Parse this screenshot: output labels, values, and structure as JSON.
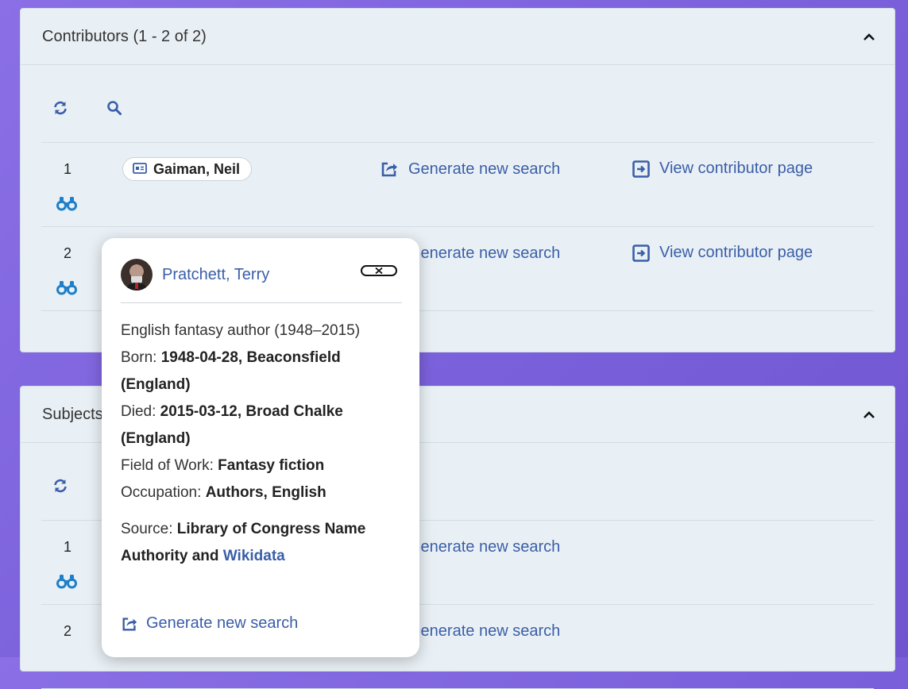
{
  "contributors": {
    "title": "Contributors (1 - 2 of 2)",
    "rows": [
      {
        "number": "1",
        "name": "Gaiman, Neil",
        "generate_label": "Generate new search",
        "view_label": "View contributor page"
      },
      {
        "number": "2",
        "generate_label": "Generate new search",
        "view_label": "View contributor page"
      }
    ]
  },
  "subjects": {
    "title": "Subjects",
    "rows": [
      {
        "number": "1",
        "generate_label": "Generate new search"
      },
      {
        "number": "2",
        "generate_label": "Generate new search"
      }
    ]
  },
  "popover": {
    "name": "Pratchett, Terry",
    "description": "English fantasy author (1948–2015)",
    "born_label": "Born:",
    "born_value": "1948-04-28, Beaconsfield (England)",
    "died_label": "Died:",
    "died_value": "2015-03-12, Broad Chalke (England)",
    "field_label": "Field of Work:",
    "field_value": "Fantasy fiction",
    "occupation_label": "Occupation:",
    "occupation_value": "Authors, English",
    "source_label": "Source:",
    "source_value": "Library of Congress Name Authority and",
    "source_link": "Wikidata",
    "generate_label": "Generate new search"
  },
  "colors": {
    "accent": "#3a5ea8",
    "binoculars": "#1f7fc8",
    "panel_bg": "#e9f0f5"
  }
}
